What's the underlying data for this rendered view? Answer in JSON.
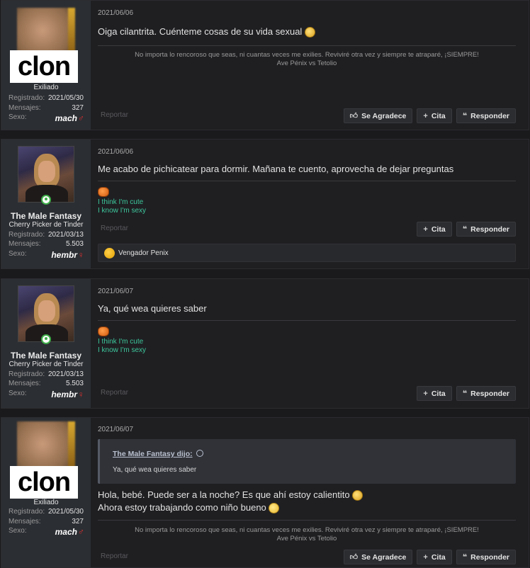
{
  "posts": [
    {
      "user": {
        "display_image_text": "clon",
        "title": "Exiliado",
        "registered_label": "Registrado:",
        "registered": "2021/05/30",
        "messages_label": "Mensajes:",
        "messages": "327",
        "sex_label": "Sexo:",
        "sex": "mach",
        "sex_symbol": "♂"
      },
      "date": "2021/06/06",
      "body": "Oiga cilantrita. Cuénteme cosas de su vida sexual",
      "signature": [
        "No importa lo rencoroso que seas, ni cuantas veces me exilies. Reviviré otra vez y siempre te atraparé, ¡SIEMPRE!",
        "Ave Pénix vs Tetolio"
      ],
      "report": "Reportar",
      "actions": {
        "like": "Se Agradece",
        "quote": "Cita",
        "reply": "Responder"
      }
    },
    {
      "user": {
        "name": "The Male Fantasy",
        "title": "Cherry Picker de Tinder",
        "registered_label": "Registrado:",
        "registered": "2021/03/13",
        "messages_label": "Mensajes:",
        "messages": "5.503",
        "sex_label": "Sexo:",
        "sex": "hembr",
        "sex_symbol": "♀"
      },
      "date": "2021/06/06",
      "body": "Me acabo de pichicatear para dormir. Mañana te cuento, aprovecha de dejar preguntas",
      "signature": [
        "I think I'm cute",
        "I know I'm sexy"
      ],
      "report": "Reportar",
      "actions": {
        "quote": "Cita",
        "reply": "Responder"
      },
      "reaction": "Vengador Penix"
    },
    {
      "user": {
        "name": "The Male Fantasy",
        "title": "Cherry Picker de Tinder",
        "registered_label": "Registrado:",
        "registered": "2021/03/13",
        "messages_label": "Mensajes:",
        "messages": "5.503",
        "sex_label": "Sexo:",
        "sex": "hembr",
        "sex_symbol": "♀"
      },
      "date": "2021/06/07",
      "body": "Ya, qué wea quieres saber",
      "signature": [
        "I think I'm cute",
        "I know I'm sexy"
      ],
      "report": "Reportar",
      "actions": {
        "quote": "Cita",
        "reply": "Responder"
      }
    },
    {
      "user": {
        "display_image_text": "clon",
        "title": "Exiliado",
        "registered_label": "Registrado:",
        "registered": "2021/05/30",
        "messages_label": "Mensajes:",
        "messages": "327",
        "sex_label": "Sexo:",
        "sex": "mach",
        "sex_symbol": "♂"
      },
      "date": "2021/06/07",
      "quote": {
        "author": "The Male Fantasy dijo:",
        "text": "Ya, qué wea quieres saber"
      },
      "body_lines": [
        "Hola, bebé. Puede ser a la noche? Es que ahí estoy calientito",
        "Ahora estoy trabajando como niño bueno"
      ],
      "signature": [
        "No importa lo rencoroso que seas, ni cuantas veces me exilies. Reviviré otra vez y siempre te atraparé, ¡SIEMPRE!",
        "Ave Pénix vs Tetolio"
      ],
      "report": "Reportar",
      "actions": {
        "like": "Se Agradece",
        "quote": "Cita",
        "reply": "Responder"
      }
    }
  ],
  "icons": {
    "like": "thumbs-up-icon",
    "quote": "plus-icon",
    "reply": "quote-marks-icon",
    "online": "online-status-icon"
  },
  "colors": {
    "background": "#1a1a1d",
    "sidebar": "#2b2e33",
    "signature_green": "#3dc79b",
    "sex_symbol": "#e03030",
    "online": "#3fae49"
  }
}
